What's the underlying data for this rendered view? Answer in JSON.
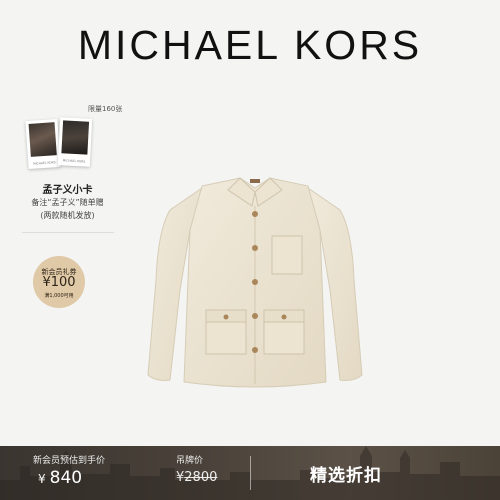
{
  "brand": {
    "name": "MICHAEL KORS"
  },
  "promo": {
    "limit_text": "限量160张",
    "polaroid_caption_1": "MICHAEL KORS",
    "polaroid_caption_2": "MICHAEL KORS",
    "title": "孟子义小卡",
    "line1": "备注“孟子义”随单赠",
    "line2": "(两款随机发放)"
  },
  "coupon": {
    "title": "新会员礼券",
    "amount": "¥100",
    "condition": "满1,000可用"
  },
  "product": {
    "name": "jacket"
  },
  "price_bar": {
    "member_label": "新会员预估到手价",
    "currency": "¥",
    "member_price": "840",
    "tag_label": "吊牌价",
    "tag_price": "2800",
    "cta_label": "精选折扣"
  },
  "colors": {
    "background": "#f4f4f2",
    "jacket": "#ede5d3",
    "coupon": "#e0c9a6",
    "bar": "#4a423a"
  }
}
